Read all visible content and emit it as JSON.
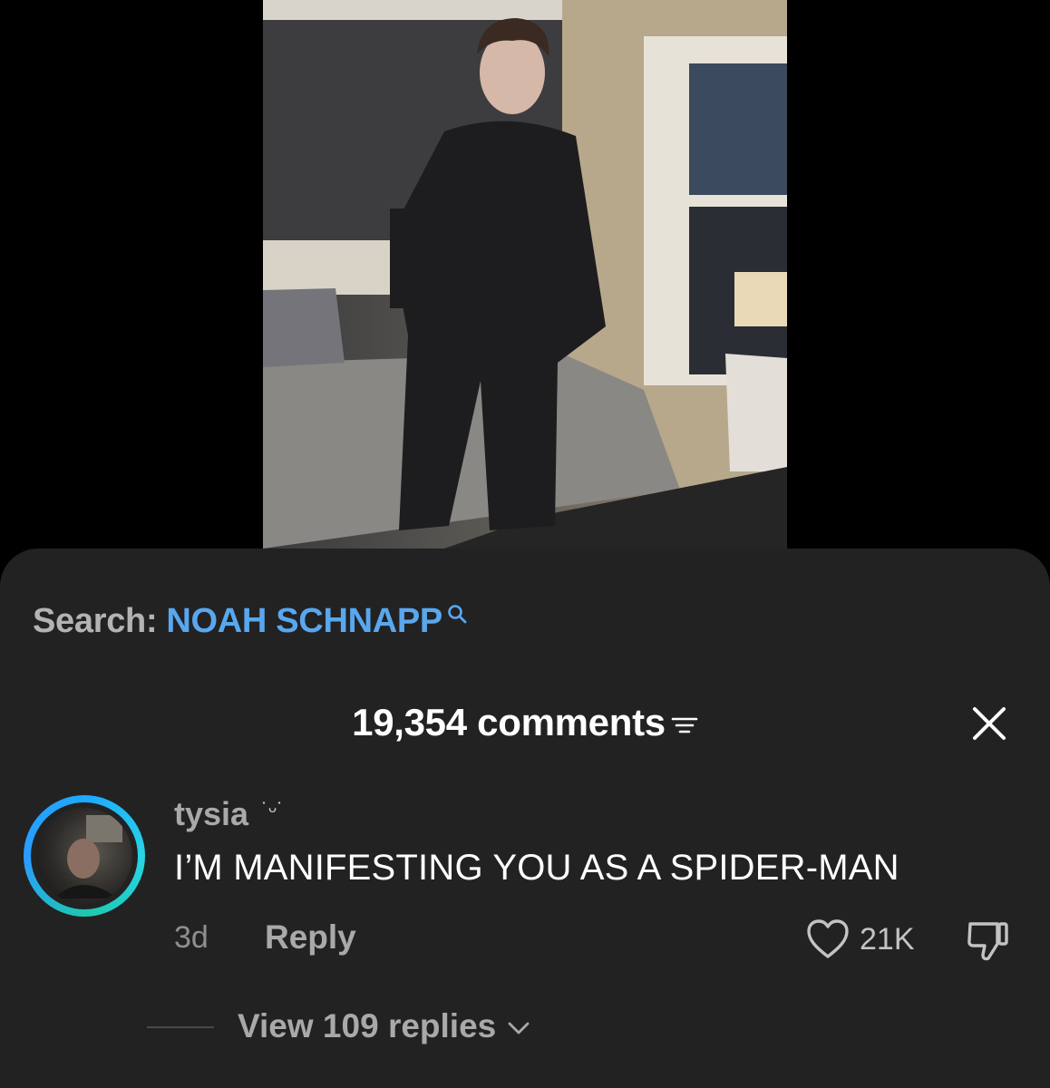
{
  "search": {
    "prefix": "Search:",
    "query": "NOAH SCHNAPP",
    "icon": "search-icon"
  },
  "header": {
    "comments_count": "19,354 comments",
    "filter_icon": "filter-icon",
    "close_icon": "close-icon"
  },
  "comment": {
    "username": "tysia",
    "username_emoticon": "˙ᵕ˙",
    "text": "I’M MANIFESTING YOU AS A SPIDER-MAN",
    "timestamp": "3d",
    "reply_label": "Reply",
    "like_count": "21K",
    "view_replies_label": "View 109 replies"
  },
  "colors": {
    "sheet_background": "#222223",
    "search_link": "#59a7ee",
    "avatar_ring": "#1ea8ff"
  }
}
